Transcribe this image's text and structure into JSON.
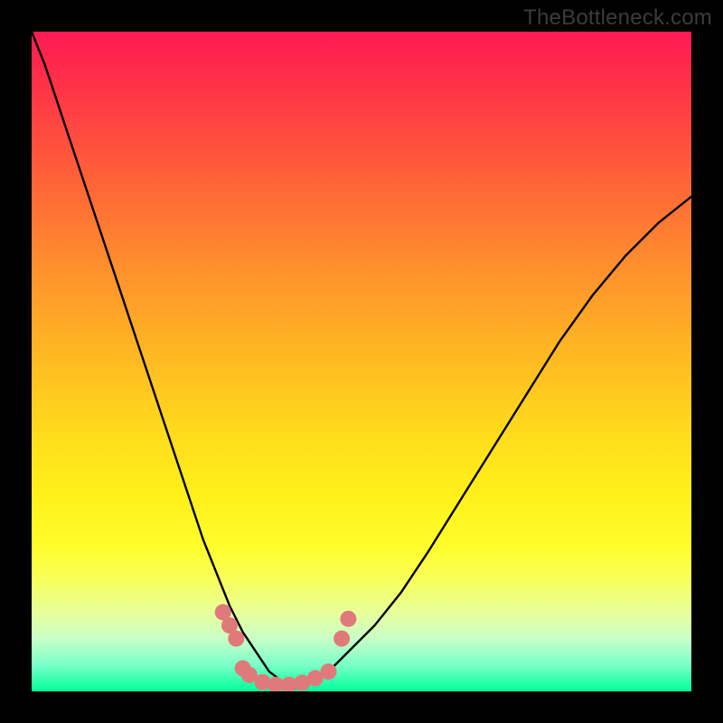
{
  "watermark": "TheBottleneck.com",
  "colors": {
    "background": "#000000",
    "curve": "#000000",
    "marker": "#e07a7a",
    "gradient_top": "#ff1a53",
    "gradient_bottom": "#00ff99"
  },
  "chart_data": {
    "type": "line",
    "title": "",
    "xlabel": "",
    "ylabel": "",
    "xlim": [
      0,
      100
    ],
    "ylim": [
      0,
      100
    ],
    "x": [
      0,
      2,
      4,
      6,
      8,
      10,
      12,
      14,
      16,
      18,
      20,
      22,
      24,
      26,
      28,
      30,
      32,
      34,
      36,
      38,
      40,
      42,
      45,
      48,
      52,
      56,
      60,
      65,
      70,
      75,
      80,
      85,
      90,
      95,
      100
    ],
    "series": [
      {
        "name": "bottleneck-curve",
        "values": [
          100,
          95,
          89,
          83,
          77,
          71,
          65,
          59,
          53,
          47,
          41,
          35,
          29,
          23,
          18,
          13,
          9,
          6,
          3,
          1.5,
          0.5,
          1.2,
          3,
          6,
          10,
          15,
          21,
          29,
          37,
          45,
          53,
          60,
          66,
          71,
          75
        ]
      }
    ],
    "markers": {
      "name": "bottleneck-points",
      "points": [
        {
          "x": 29,
          "y": 12
        },
        {
          "x": 30,
          "y": 10
        },
        {
          "x": 31,
          "y": 8
        },
        {
          "x": 32,
          "y": 3.5
        },
        {
          "x": 33,
          "y": 2.5
        },
        {
          "x": 35,
          "y": 1.4
        },
        {
          "x": 37,
          "y": 1
        },
        {
          "x": 39,
          "y": 1
        },
        {
          "x": 41,
          "y": 1.3
        },
        {
          "x": 43,
          "y": 2
        },
        {
          "x": 45,
          "y": 3
        },
        {
          "x": 47,
          "y": 8
        },
        {
          "x": 48,
          "y": 11
        }
      ]
    }
  }
}
